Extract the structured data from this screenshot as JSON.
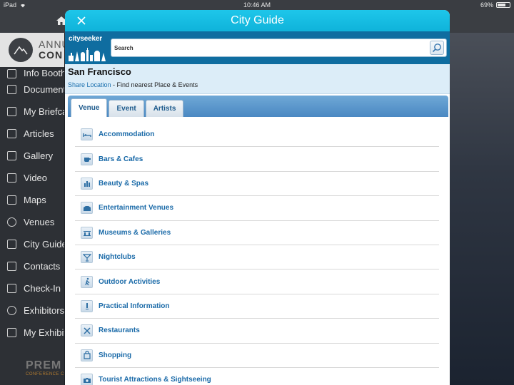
{
  "status_bar": {
    "device": "iPad",
    "time": "10:46 AM",
    "battery": "69%",
    "battery_level": 0.69
  },
  "background_app": {
    "brand_line1": "ANNU",
    "brand_line2": "CON",
    "menu": [
      {
        "label": "Info Booth",
        "icon": "info-icon"
      },
      {
        "label": "Documents",
        "icon": "documents-icon"
      },
      {
        "label": "My Briefcase",
        "icon": "briefcase-icon"
      },
      {
        "label": "Articles",
        "icon": "articles-icon"
      },
      {
        "label": "Gallery",
        "icon": "gallery-icon"
      },
      {
        "label": "Video",
        "icon": "video-icon"
      },
      {
        "label": "Maps",
        "icon": "maps-icon"
      },
      {
        "label": "Venues",
        "icon": "location-pin-icon"
      },
      {
        "label": "City Guide",
        "icon": "city-guide-icon"
      },
      {
        "label": "Contacts",
        "icon": "contacts-icon"
      },
      {
        "label": "Check-In",
        "icon": "check-in-icon"
      },
      {
        "label": "Exhibitors",
        "icon": "globe-icon"
      },
      {
        "label": "My Exhibitors",
        "icon": "exhibitors-icon"
      }
    ],
    "footer_brand": "PREM",
    "footer_tagline": "CONFERENCE C"
  },
  "modal": {
    "title": "City Guide",
    "logo_text": "cityseeker",
    "search": {
      "placeholder": "Search",
      "value": ""
    },
    "city": "San Francisco",
    "share_link": "Share Location",
    "share_text": " - Find nearest Place & Events",
    "tabs": [
      {
        "label": "Venue",
        "active": true
      },
      {
        "label": "Event",
        "active": false
      },
      {
        "label": "Artists",
        "active": false
      }
    ],
    "categories": [
      {
        "label": "Accommodation",
        "icon": "bed-icon"
      },
      {
        "label": "Bars & Cafes",
        "icon": "coffee-cup-icon"
      },
      {
        "label": "Beauty & Spas",
        "icon": "spa-icon"
      },
      {
        "label": "Entertainment Venues",
        "icon": "theater-icon"
      },
      {
        "label": "Museums & Galleries",
        "icon": "museum-icon"
      },
      {
        "label": "Nightclubs",
        "icon": "cocktail-icon"
      },
      {
        "label": "Outdoor Activities",
        "icon": "hiker-icon"
      },
      {
        "label": "Practical Information",
        "icon": "info-icon"
      },
      {
        "label": "Restaurants",
        "icon": "fork-knife-icon"
      },
      {
        "label": "Shopping",
        "icon": "shopping-bag-icon"
      },
      {
        "label": "Tourist Attractions & Sightseeing",
        "icon": "camera-icon"
      }
    ]
  }
}
